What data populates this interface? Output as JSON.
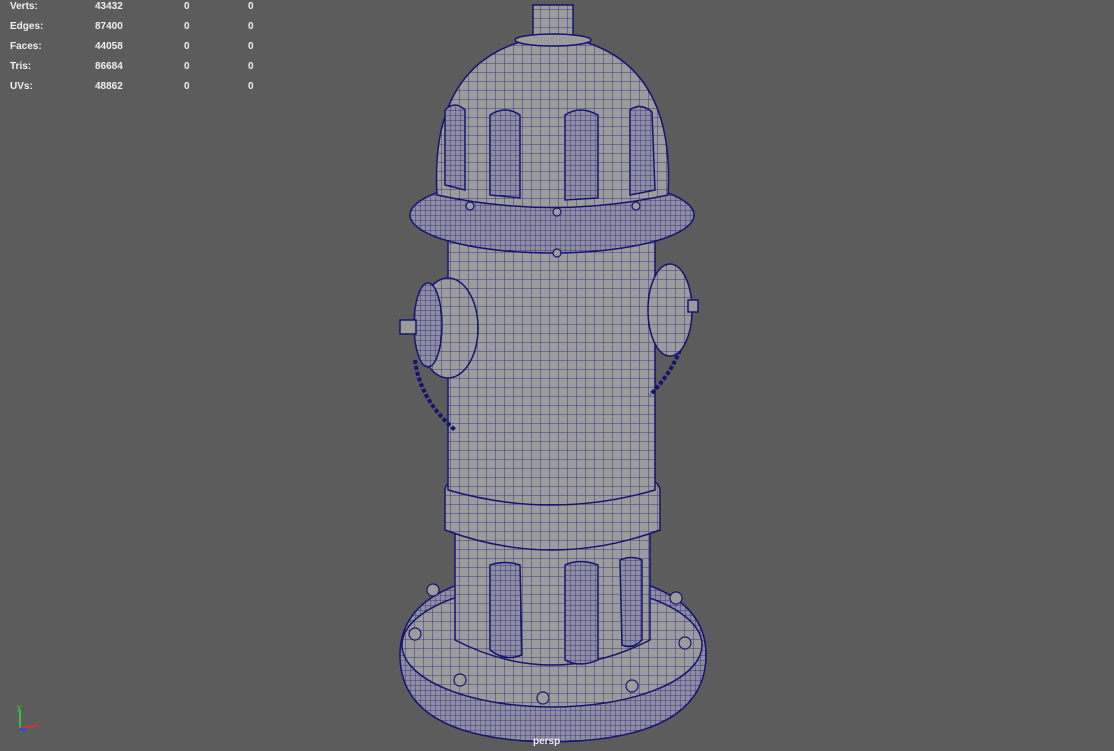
{
  "hud": {
    "rows": [
      {
        "label": "Verts:",
        "v1": "43432",
        "v2": "0",
        "v3": "0"
      },
      {
        "label": "Edges:",
        "v1": "87400",
        "v2": "0",
        "v3": "0"
      },
      {
        "label": "Faces:",
        "v1": "44058",
        "v2": "0",
        "v3": "0"
      },
      {
        "label": "Tris:",
        "v1": "86684",
        "v2": "0",
        "v3": "0"
      },
      {
        "label": "UVs:",
        "v1": "48862",
        "v2": "0",
        "v3": "0"
      }
    ]
  },
  "camera_label": "persp",
  "axis": {
    "x": "x",
    "y": "y",
    "z": "z"
  },
  "colors": {
    "background": "#5c5c5c",
    "mesh": "#9c9c9c",
    "wire": "#1c1c80"
  }
}
